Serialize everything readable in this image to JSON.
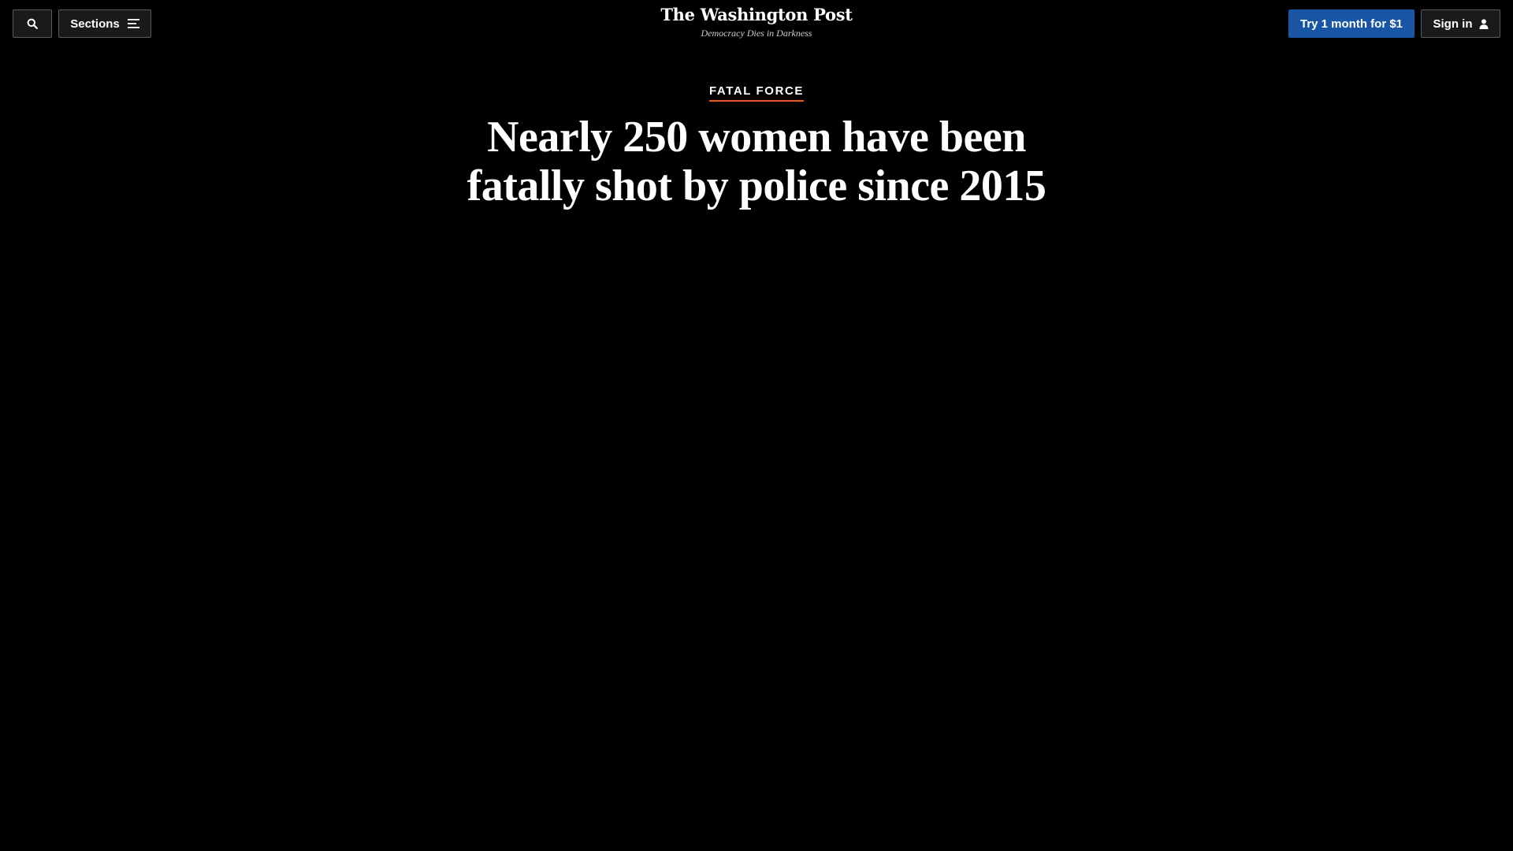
{
  "header": {
    "search_icon": "search-icon",
    "sections_label": "Sections",
    "sections_icon": "menu-lines-icon",
    "logo_text": "The Washington Post",
    "tagline": "Democracy Dies in Darkness",
    "subscribe_label": "Try 1 month for $1",
    "signin_label": "Sign in",
    "signin_icon": "user-icon"
  },
  "article": {
    "kicker": "FATAL FORCE",
    "headline_lines": [
      "Nearly 250 women have been",
      "fatally shot by police since 2015"
    ]
  },
  "colors": {
    "background": "#000000",
    "subscribe_button": "#1955a5",
    "kicker_underline": "#e5581e",
    "button_border": "#5a5a5a"
  }
}
